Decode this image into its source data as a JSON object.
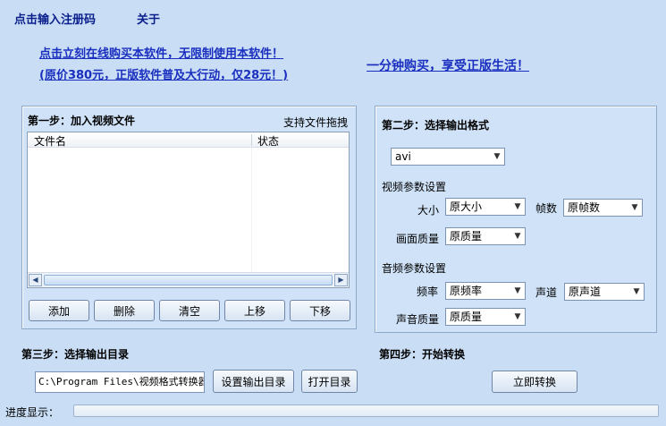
{
  "menu": {
    "register": "点击输入注册码",
    "about": "关于"
  },
  "promo": {
    "line1": "点击立刻在线购买本软件，无限制使用本软件！",
    "line2": "(原价380元，正版软件普及大行动，仅28元！)",
    "slogan": "一分钟购买，享受正版生活！"
  },
  "step1": {
    "title": "第一步：加入视频文件",
    "drag_hint": "支持文件拖拽",
    "columns": [
      "文件名",
      "状态"
    ],
    "buttons": {
      "add": "添加",
      "delete": "删除",
      "clear": "清空",
      "up": "上移",
      "down": "下移"
    }
  },
  "step2": {
    "title": "第二步：选择输出格式",
    "format": "avi",
    "video_section": "视频参数设置",
    "size_label": "大小",
    "size_value": "原大小",
    "fps_label": "帧数",
    "fps_value": "原帧数",
    "quality_label": "画面质量",
    "quality_value": "原质量",
    "audio_section": "音频参数设置",
    "freq_label": "频率",
    "freq_value": "原频率",
    "channel_label": "声道",
    "channel_value": "原声道",
    "sound_quality_label": "声音质量",
    "sound_quality_value": "原质量"
  },
  "step3": {
    "title": "第三步：选择输出目录",
    "path": "C:\\Program Files\\视频格式转换器",
    "set_dir": "设置输出目录",
    "open_dir": "打开目录"
  },
  "step4": {
    "title": "第四步：开始转换",
    "convert": "立即转换"
  },
  "progress": {
    "label": "进度显示：",
    "value": 0
  }
}
